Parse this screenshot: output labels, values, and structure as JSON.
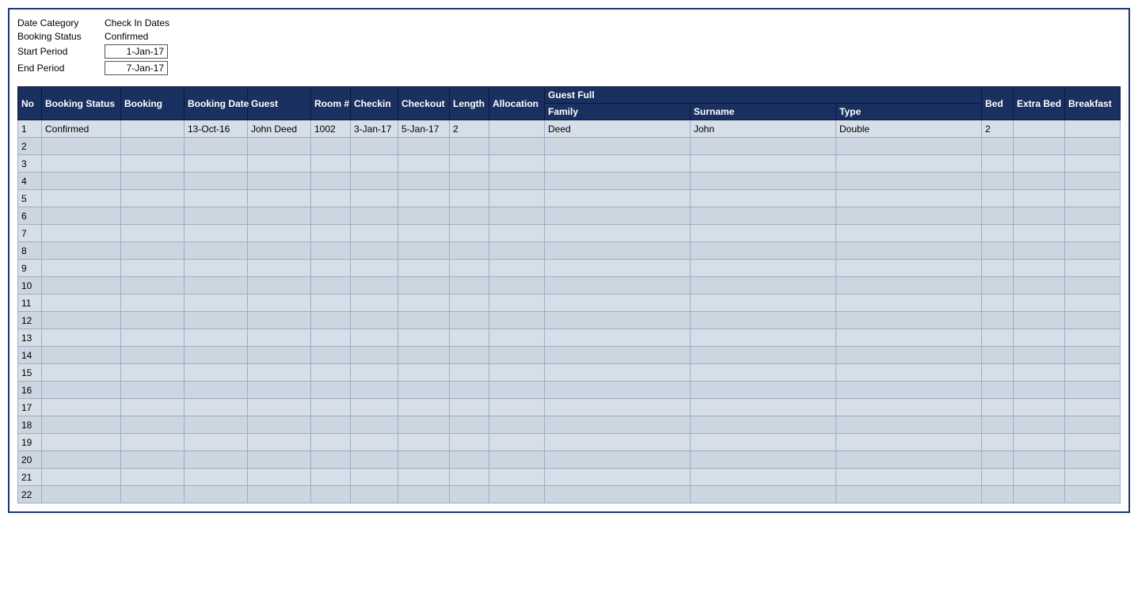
{
  "filter": {
    "date_category_label": "Date Category",
    "date_category_value": "Check In Dates",
    "booking_status_label": "Booking Status",
    "booking_status_value": "Confirmed",
    "start_period_label": "Start Period",
    "start_period_value": "1-Jan-17",
    "end_period_label": "End Period",
    "end_period_value": "7-Jan-17"
  },
  "table": {
    "headers_top": {
      "no": "No",
      "booking_status": "Booking Status",
      "booking": "Booking",
      "booking_date": "Booking Date",
      "guest": "Guest",
      "guest_full": "Guest Full"
    },
    "headers_sub": {
      "room": "Room #",
      "checkin": "Checkin",
      "checkout": "Checkout",
      "length": "Length",
      "allocation": "Allocation",
      "family": "Family",
      "surname": "Surname",
      "type": "Type",
      "bed": "Bed",
      "extra_bed": "Extra Bed",
      "breakfast": "Breakfast"
    },
    "rows": [
      {
        "no": "1",
        "booking_status": "Confirmed",
        "booking": "",
        "booking_date": "13-Oct-16",
        "guest": "John Deed",
        "room": "1002",
        "checkin": "3-Jan-17",
        "checkout": "5-Jan-17",
        "length": "2",
        "allocation": "",
        "family": "Deed",
        "surname": "John",
        "type": "Double",
        "bed": "2",
        "extra_bed": "",
        "breakfast": ""
      },
      {
        "no": "2",
        "booking_status": "",
        "booking": "",
        "booking_date": "",
        "guest": "",
        "room": "",
        "checkin": "",
        "checkout": "",
        "length": "",
        "allocation": "",
        "family": "",
        "surname": "",
        "type": "",
        "bed": "",
        "extra_bed": "",
        "breakfast": ""
      },
      {
        "no": "3",
        "booking_status": "",
        "booking": "",
        "booking_date": "",
        "guest": "",
        "room": "",
        "checkin": "",
        "checkout": "",
        "length": "",
        "allocation": "",
        "family": "",
        "surname": "",
        "type": "",
        "bed": "",
        "extra_bed": "",
        "breakfast": ""
      },
      {
        "no": "4",
        "booking_status": "",
        "booking": "",
        "booking_date": "",
        "guest": "",
        "room": "",
        "checkin": "",
        "checkout": "",
        "length": "",
        "allocation": "",
        "family": "",
        "surname": "",
        "type": "",
        "bed": "",
        "extra_bed": "",
        "breakfast": ""
      },
      {
        "no": "5",
        "booking_status": "",
        "booking": "",
        "booking_date": "",
        "guest": "",
        "room": "",
        "checkin": "",
        "checkout": "",
        "length": "",
        "allocation": "",
        "family": "",
        "surname": "",
        "type": "",
        "bed": "",
        "extra_bed": "",
        "breakfast": ""
      },
      {
        "no": "6",
        "booking_status": "",
        "booking": "",
        "booking_date": "",
        "guest": "",
        "room": "",
        "checkin": "",
        "checkout": "",
        "length": "",
        "allocation": "",
        "family": "",
        "surname": "",
        "type": "",
        "bed": "",
        "extra_bed": "",
        "breakfast": ""
      },
      {
        "no": "7",
        "booking_status": "",
        "booking": "",
        "booking_date": "",
        "guest": "",
        "room": "",
        "checkin": "",
        "checkout": "",
        "length": "",
        "allocation": "",
        "family": "",
        "surname": "",
        "type": "",
        "bed": "",
        "extra_bed": "",
        "breakfast": ""
      },
      {
        "no": "8",
        "booking_status": "",
        "booking": "",
        "booking_date": "",
        "guest": "",
        "room": "",
        "checkin": "",
        "checkout": "",
        "length": "",
        "allocation": "",
        "family": "",
        "surname": "",
        "type": "",
        "bed": "",
        "extra_bed": "",
        "breakfast": ""
      },
      {
        "no": "9",
        "booking_status": "",
        "booking": "",
        "booking_date": "",
        "guest": "",
        "room": "",
        "checkin": "",
        "checkout": "",
        "length": "",
        "allocation": "",
        "family": "",
        "surname": "",
        "type": "",
        "bed": "",
        "extra_bed": "",
        "breakfast": ""
      },
      {
        "no": "10",
        "booking_status": "",
        "booking": "",
        "booking_date": "",
        "guest": "",
        "room": "",
        "checkin": "",
        "checkout": "",
        "length": "",
        "allocation": "",
        "family": "",
        "surname": "",
        "type": "",
        "bed": "",
        "extra_bed": "",
        "breakfast": ""
      },
      {
        "no": "11",
        "booking_status": "",
        "booking": "",
        "booking_date": "",
        "guest": "",
        "room": "",
        "checkin": "",
        "checkout": "",
        "length": "",
        "allocation": "",
        "family": "",
        "surname": "",
        "type": "",
        "bed": "",
        "extra_bed": "",
        "breakfast": ""
      },
      {
        "no": "12",
        "booking_status": "",
        "booking": "",
        "booking_date": "",
        "guest": "",
        "room": "",
        "checkin": "",
        "checkout": "",
        "length": "",
        "allocation": "",
        "family": "",
        "surname": "",
        "type": "",
        "bed": "",
        "extra_bed": "",
        "breakfast": ""
      },
      {
        "no": "13",
        "booking_status": "",
        "booking": "",
        "booking_date": "",
        "guest": "",
        "room": "",
        "checkin": "",
        "checkout": "",
        "length": "",
        "allocation": "",
        "family": "",
        "surname": "",
        "type": "",
        "bed": "",
        "extra_bed": "",
        "breakfast": ""
      },
      {
        "no": "14",
        "booking_status": "",
        "booking": "",
        "booking_date": "",
        "guest": "",
        "room": "",
        "checkin": "",
        "checkout": "",
        "length": "",
        "allocation": "",
        "family": "",
        "surname": "",
        "type": "",
        "bed": "",
        "extra_bed": "",
        "breakfast": ""
      },
      {
        "no": "15",
        "booking_status": "",
        "booking": "",
        "booking_date": "",
        "guest": "",
        "room": "",
        "checkin": "",
        "checkout": "",
        "length": "",
        "allocation": "",
        "family": "",
        "surname": "",
        "type": "",
        "bed": "",
        "extra_bed": "",
        "breakfast": ""
      },
      {
        "no": "16",
        "booking_status": "",
        "booking": "",
        "booking_date": "",
        "guest": "",
        "room": "",
        "checkin": "",
        "checkout": "",
        "length": "",
        "allocation": "",
        "family": "",
        "surname": "",
        "type": "",
        "bed": "",
        "extra_bed": "",
        "breakfast": ""
      },
      {
        "no": "17",
        "booking_status": "",
        "booking": "",
        "booking_date": "",
        "guest": "",
        "room": "",
        "checkin": "",
        "checkout": "",
        "length": "",
        "allocation": "",
        "family": "",
        "surname": "",
        "type": "",
        "bed": "",
        "extra_bed": "",
        "breakfast": ""
      },
      {
        "no": "18",
        "booking_status": "",
        "booking": "",
        "booking_date": "",
        "guest": "",
        "room": "",
        "checkin": "",
        "checkout": "",
        "length": "",
        "allocation": "",
        "family": "",
        "surname": "",
        "type": "",
        "bed": "",
        "extra_bed": "",
        "breakfast": ""
      },
      {
        "no": "19",
        "booking_status": "",
        "booking": "",
        "booking_date": "",
        "guest": "",
        "room": "",
        "checkin": "",
        "checkout": "",
        "length": "",
        "allocation": "",
        "family": "",
        "surname": "",
        "type": "",
        "bed": "",
        "extra_bed": "",
        "breakfast": ""
      },
      {
        "no": "20",
        "booking_status": "",
        "booking": "",
        "booking_date": "",
        "guest": "",
        "room": "",
        "checkin": "",
        "checkout": "",
        "length": "",
        "allocation": "",
        "family": "",
        "surname": "",
        "type": "",
        "bed": "",
        "extra_bed": "",
        "breakfast": ""
      },
      {
        "no": "21",
        "booking_status": "",
        "booking": "",
        "booking_date": "",
        "guest": "",
        "room": "",
        "checkin": "",
        "checkout": "",
        "length": "",
        "allocation": "",
        "family": "",
        "surname": "",
        "type": "",
        "bed": "",
        "extra_bed": "",
        "breakfast": ""
      },
      {
        "no": "22",
        "booking_status": "",
        "booking": "",
        "booking_date": "",
        "guest": "",
        "room": "",
        "checkin": "",
        "checkout": "",
        "length": "",
        "allocation": "",
        "family": "",
        "surname": "",
        "type": "",
        "bed": "",
        "extra_bed": "",
        "breakfast": ""
      }
    ]
  }
}
